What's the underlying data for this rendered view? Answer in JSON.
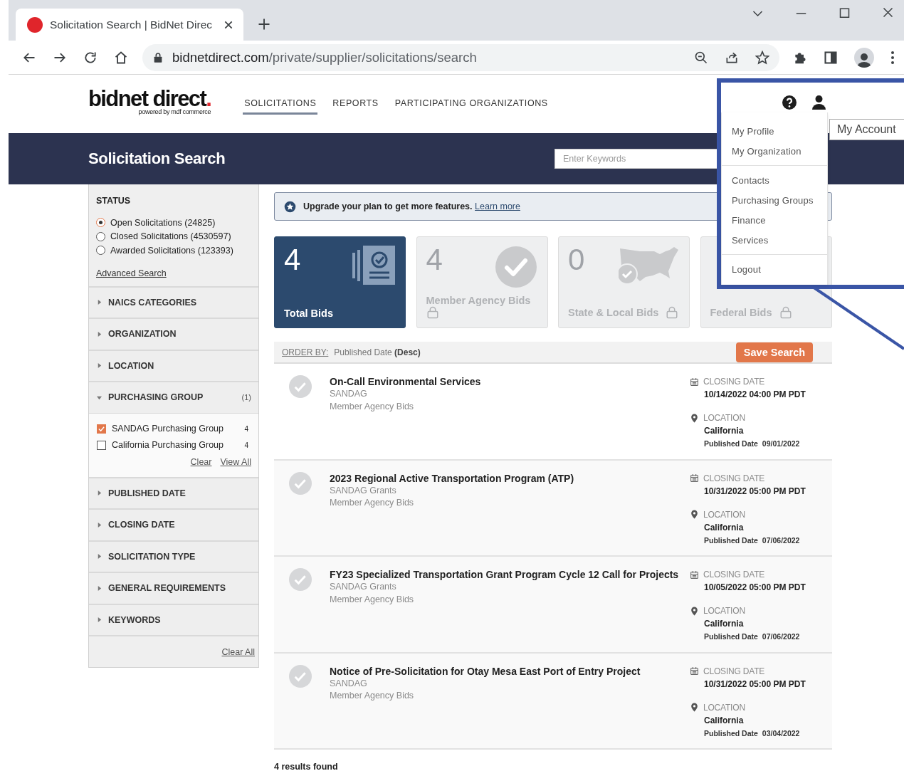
{
  "browser": {
    "tab_title": "Solicitation Search | BidNet Direc",
    "url_host": "bidnetdirect.com",
    "url_path": "/private/supplier/solicitations/search"
  },
  "header": {
    "logo": "bidnet direct",
    "logo_dot": ".",
    "tagline": "powered by mdf commerce",
    "nav": [
      {
        "label": "SOLICITATIONS",
        "selected": true
      },
      {
        "label": "REPORTS",
        "selected": false
      },
      {
        "label": "PARTICIPATING ORGANIZATIONS",
        "selected": false
      }
    ]
  },
  "banner": {
    "title": "Solicitation Search",
    "search": {
      "placeholder": "Enter Keywords"
    }
  },
  "sidebar": {
    "status_title": "STATUS",
    "status_options": [
      {
        "label": "Open Solicitations (24825)",
        "selected": true
      },
      {
        "label": "Closed Solicitations (4530597)",
        "selected": false
      },
      {
        "label": "Awarded Solicitations (123393)",
        "selected": false
      }
    ],
    "advanced_link": "Advanced Search",
    "facets": [
      {
        "label": "NAICS CATEGORIES",
        "expanded": false
      },
      {
        "label": "ORGANIZATION",
        "expanded": false
      },
      {
        "label": "LOCATION",
        "expanded": false
      },
      {
        "label": "PURCHASING GROUP",
        "expanded": true,
        "count": "(1)",
        "options": [
          {
            "label": "SANDAG Purchasing Group",
            "checked": true,
            "count": "4"
          },
          {
            "label": "California Purchasing Group",
            "checked": false,
            "count": "4"
          }
        ],
        "links": [
          "Clear",
          "View All"
        ]
      },
      {
        "label": "PUBLISHED DATE",
        "expanded": false
      },
      {
        "label": "CLOSING DATE",
        "expanded": false
      },
      {
        "label": "SOLICITATION TYPE",
        "expanded": false
      },
      {
        "label": "GENERAL REQUIREMENTS",
        "expanded": false
      },
      {
        "label": "KEYWORDS",
        "expanded": false
      }
    ],
    "clear_all": "Clear All"
  },
  "upgrade": {
    "text": "Upgrade your plan to get more features.",
    "link": "Learn more"
  },
  "cards": [
    {
      "kind": "documents",
      "count": "4",
      "label": "Total Bids",
      "selected": true,
      "locked": false
    },
    {
      "kind": "check",
      "count": "4",
      "label": "Member Agency Bids",
      "selected": false,
      "locked": true
    },
    {
      "kind": "map",
      "count": "0",
      "label": "State & Local Bids",
      "selected": false,
      "locked": true
    },
    {
      "kind": "federal",
      "label": "Federal Bids",
      "selected": false,
      "locked": true
    }
  ],
  "order_bar": {
    "label": "ORDER BY:",
    "field": "Published Date",
    "direction": "(Desc)",
    "save_button": "Save Search"
  },
  "results": [
    {
      "title": "On-Call Environmental Services",
      "organization": "SANDAG",
      "type": "Member Agency Bids",
      "closing_label": "CLOSING DATE",
      "closing_date": "10/14/2022 04:00 PM PDT",
      "location_label": "LOCATION",
      "location": "California",
      "published_label": "Published Date",
      "published_date": "09/01/2022"
    },
    {
      "title": "2023 Regional Active Transportation Program (ATP)",
      "organization": "SANDAG Grants",
      "type": "Member Agency Bids",
      "closing_label": "CLOSING DATE",
      "closing_date": "10/31/2022 05:00 PM PDT",
      "location_label": "LOCATION",
      "location": "California",
      "published_label": "Published Date",
      "published_date": "07/06/2022"
    },
    {
      "title": "FY23 Specialized Transportation Grant Program Cycle 12 Call for Projects",
      "organization": "SANDAG Grants",
      "type": "Member Agency Bids",
      "closing_label": "CLOSING DATE",
      "closing_date": "10/05/2022 05:00 PM PDT",
      "location_label": "LOCATION",
      "location": "California",
      "published_label": "Published Date",
      "published_date": "07/06/2022"
    },
    {
      "title": "Notice of Pre-Solicitation for Otay Mesa East Port of Entry Project",
      "organization": "SANDAG",
      "type": "Member Agency Bids",
      "closing_label": "CLOSING DATE",
      "closing_date": "10/31/2022 05:00 PM PDT",
      "location_label": "LOCATION",
      "location": "California",
      "published_label": "Published Date",
      "published_date": "03/04/2022"
    }
  ],
  "results_found": "4 results found",
  "account_menu": {
    "tooltip": "My Account",
    "groups": [
      {
        "items": [
          "My Profile",
          "My Organization"
        ]
      },
      {
        "items": [
          "Contacts",
          "Purchasing Groups",
          "Finance",
          "Services"
        ]
      },
      {
        "items": [
          "Logout"
        ]
      }
    ]
  }
}
